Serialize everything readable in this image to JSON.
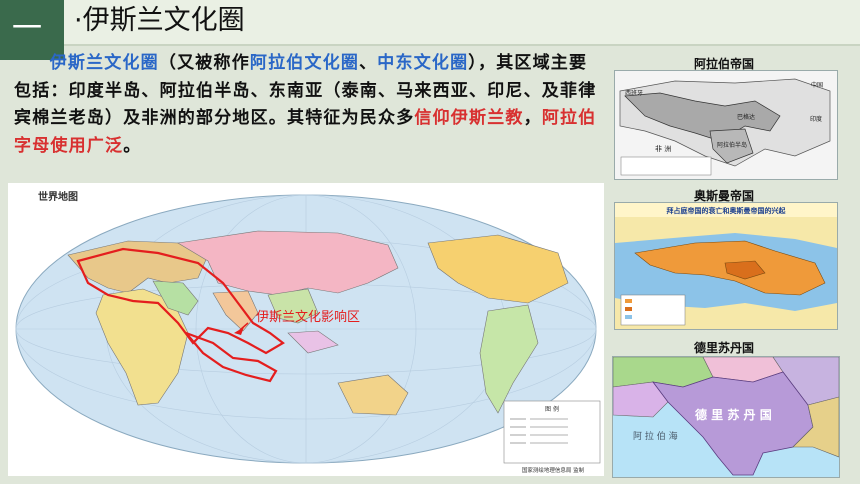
{
  "header": {
    "number": "一",
    "title": "·伊斯兰文化圈"
  },
  "paragraph": {
    "s1": "伊斯兰文化圈",
    "s2": "（又被称作",
    "s3": "阿拉伯文化圈",
    "s4": "、",
    "s5": "中东文化圈",
    "s6": "），其区域主要包括：印度半岛、阿拉伯半岛、东南亚（泰南、马来西亚、印尼、及菲律宾棉兰老岛）及非洲的部分地区。其特征为民众多",
    "s7": "信仰伊斯兰教",
    "s8": "，",
    "s9": "阿拉伯字母使用广泛",
    "s10": "。"
  },
  "world_map": {
    "title": "世界地图",
    "annotation": "伊斯兰文化影响区",
    "legend_title": "图 例",
    "footer": "国家测绘地理信息局 监制"
  },
  "map1": {
    "caption": "阿拉伯帝国",
    "labels": [
      "西班牙",
      "中国",
      "阿拉伯半岛",
      "巴格达",
      "印度",
      "非 洲"
    ]
  },
  "map2": {
    "caption": "奥斯曼帝国",
    "title": "拜占庭帝国的衰亡和奥斯曼帝国的兴起"
  },
  "map3": {
    "caption": "德里苏丹国",
    "labels": [
      "德 里 苏 丹 国",
      "阿 拉 伯 海"
    ]
  },
  "colors": {
    "header_green": "#3a6a4c",
    "highlight_blue": "#2a67c7",
    "highlight_red": "#d83030",
    "ocean": "#cfe3f2"
  }
}
